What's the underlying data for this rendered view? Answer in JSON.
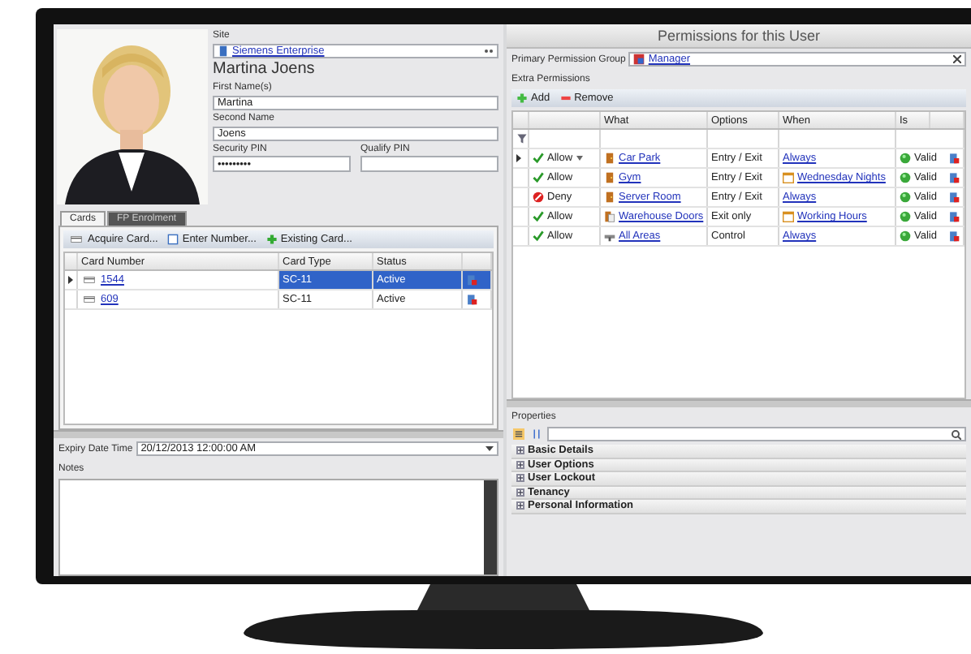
{
  "person": {
    "site_label": "Site",
    "site": "Siemens Enterprise",
    "full_name": "Martina Joens",
    "first_name_label": "First Name(s)",
    "first_name": "Martina",
    "second_name_label": "Second Name",
    "second_name": "Joens",
    "security_pin_label": "Security PIN",
    "security_pin": "•••••••••",
    "qualify_pin_label": "Qualify PIN"
  },
  "tabs": [
    {
      "label": "Cards",
      "selected": true
    },
    {
      "label": "FP Enrolment",
      "selected": false
    }
  ],
  "card_toolbar": [
    "Acquire Card...",
    "Enter Number...",
    "Existing Card..."
  ],
  "cards_table": {
    "columns": [
      "Card Number",
      "Card Type",
      "Status"
    ],
    "rows": [
      {
        "number": "1544",
        "type": "SC-11",
        "status": "Active",
        "selected": true
      },
      {
        "number": "609",
        "type": "SC-11",
        "status": "Active",
        "selected": false
      }
    ]
  },
  "expiry": {
    "label": "Expiry Date Time",
    "value": "20/12/2013 12:00:00 AM"
  },
  "notes": {
    "label": "Notes"
  },
  "permissions": {
    "title": "Permissions for this User",
    "primary_group_label": "Primary Permission Group",
    "primary_group": "Manager",
    "extra_label": "Extra Permissions",
    "toolbar": [
      "Add",
      "Remove"
    ],
    "columns": [
      "What",
      "Options",
      "When",
      "Is"
    ],
    "rows": [
      {
        "access": {
          "kind": "allow",
          "label": "Allow"
        },
        "what": {
          "kind": "door",
          "label": "Car Park"
        },
        "options": "Entry / Exit",
        "when": "Always",
        "scheduled": false,
        "is": "Valid",
        "selected": true
      },
      {
        "access": {
          "kind": "allow",
          "label": "Allow"
        },
        "what": {
          "kind": "door",
          "label": "Gym"
        },
        "options": "Entry / Exit",
        "when": "Wednesday Nights",
        "scheduled": true,
        "is": "Valid",
        "selected": false
      },
      {
        "access": {
          "kind": "deny",
          "label": "Deny"
        },
        "what": {
          "kind": "door",
          "label": "Server Room"
        },
        "options": "Entry / Exit",
        "when": "Always",
        "scheduled": false,
        "is": "Valid",
        "selected": false
      },
      {
        "access": {
          "kind": "allow",
          "label": "Allow"
        },
        "what": {
          "kind": "doors",
          "label": "Warehouse Doors"
        },
        "options": "Exit only",
        "when": "Working Hours",
        "scheduled": true,
        "is": "Valid",
        "selected": false
      },
      {
        "access": {
          "kind": "allow",
          "label": "Allow"
        },
        "what": {
          "kind": "reader",
          "label": "All Areas"
        },
        "options": "Control",
        "when": "Always",
        "scheduled": false,
        "is": "Valid",
        "selected": false
      }
    ]
  },
  "properties": {
    "label": "Properties",
    "categories": [
      {
        "label": "Basic Details",
        "expanded": false
      },
      {
        "label": "User Options",
        "expanded": false
      },
      {
        "label": "User Lockout",
        "expanded": false
      },
      {
        "label": "Tenancy",
        "expanded": false
      },
      {
        "label": "Personal Information",
        "expanded": false
      }
    ]
  }
}
